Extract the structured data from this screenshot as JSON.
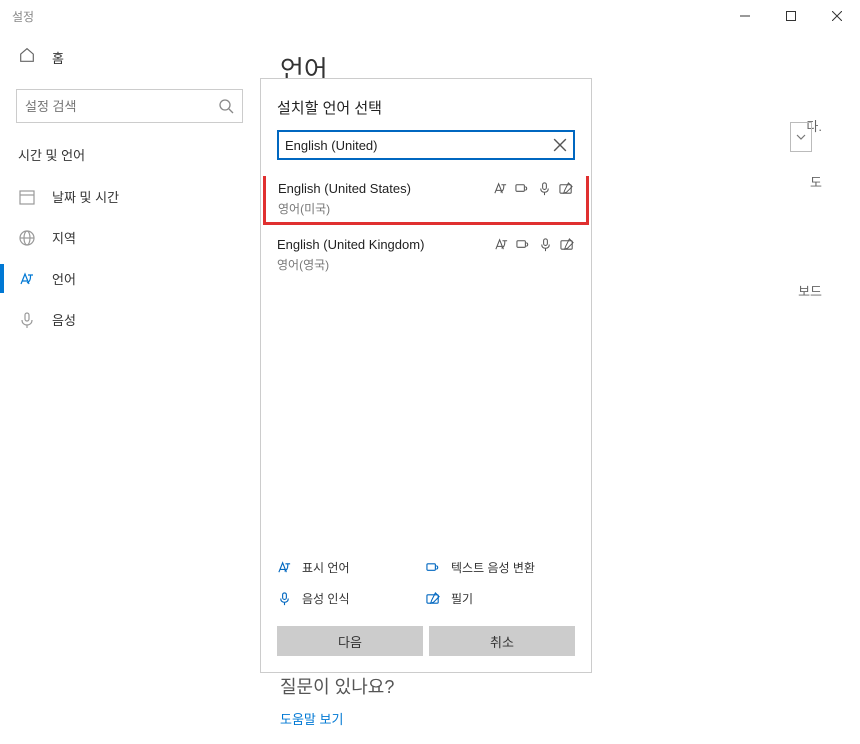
{
  "titlebar": {
    "title": "설정"
  },
  "sidebar": {
    "home": "홈",
    "search_placeholder": "설정 검색",
    "section": "시간 및 언어",
    "items": [
      {
        "label": "날짜 및 시간"
      },
      {
        "label": "지역"
      },
      {
        "label": "언어"
      },
      {
        "label": "음성"
      }
    ]
  },
  "page": {
    "heading": "언어",
    "question": "질문이 있나요?",
    "help_link": "도움말 보기"
  },
  "background_fragments": {
    "f1": "다.",
    "f2": "도",
    "f3": "보드"
  },
  "dialog": {
    "title": "설치할 언어 선택",
    "search_value": "English (United)",
    "languages": [
      {
        "name": "English (United States)",
        "native": "영어(미국)",
        "highlight": true
      },
      {
        "name": "English (United Kingdom)",
        "native": "영어(영국)",
        "highlight": false
      }
    ],
    "legend": {
      "display": "표시 언어",
      "tts": "텍스트 음성 변환",
      "speech": "음성 인식",
      "ink": "필기"
    },
    "buttons": {
      "next": "다음",
      "cancel": "취소"
    }
  }
}
